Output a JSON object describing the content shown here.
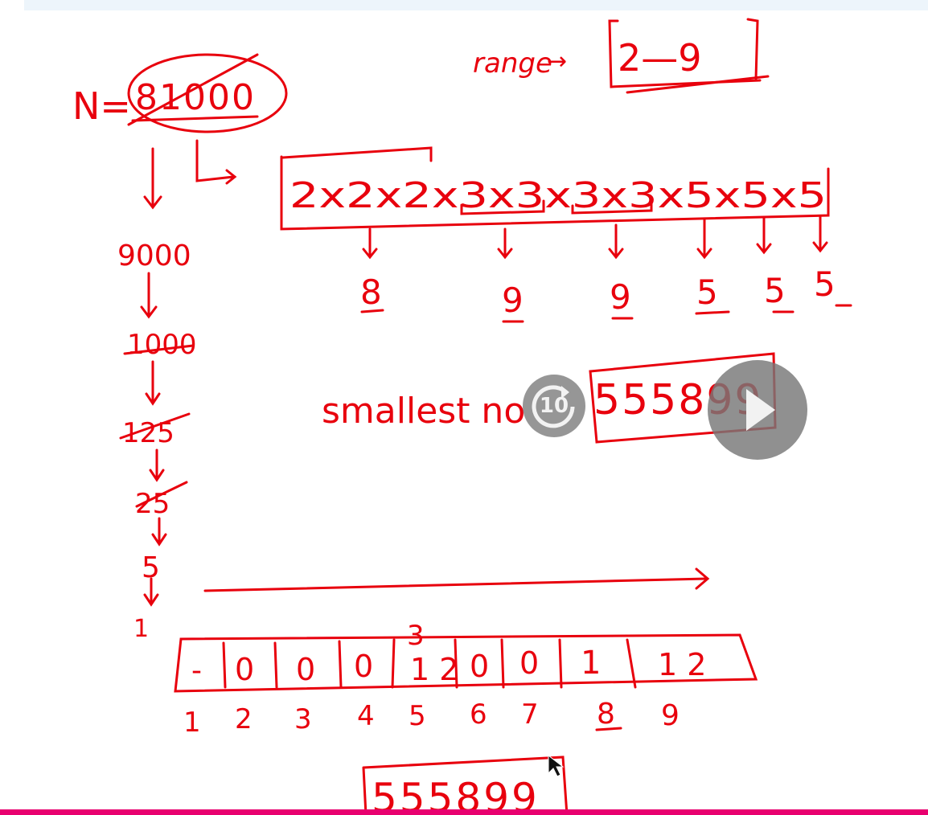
{
  "header": {
    "background": "#edf5fb"
  },
  "whiteboard": {
    "ink_color": "#e8000d",
    "n_label": "N=",
    "n_value": "81000",
    "range_label": "range",
    "range_value": "2—9",
    "factorization": "2x2x2x3x3x3x3x5x5x5",
    "groups": [
      "8",
      "9",
      "9",
      "5",
      "5",
      "5"
    ],
    "division_steps": [
      "9000",
      "1000",
      "125",
      "25",
      "5",
      "1"
    ],
    "smallest_label": "smallest no",
    "answer": "555899",
    "count_cells": [
      "-",
      "0",
      "0",
      "0",
      "1 2",
      "0",
      "0",
      "1",
      "1 2"
    ],
    "count_above": "3",
    "digit_labels": [
      "1",
      "2",
      "3",
      "4",
      "5",
      "6",
      "7",
      "8",
      "9"
    ],
    "final_answer": "555899"
  },
  "player": {
    "rewind_label": "10",
    "rewind_icon": "rewind-10-icon",
    "play_icon": "play-icon",
    "progress_fraction": 1.0,
    "progress_color": "#e8006f"
  }
}
